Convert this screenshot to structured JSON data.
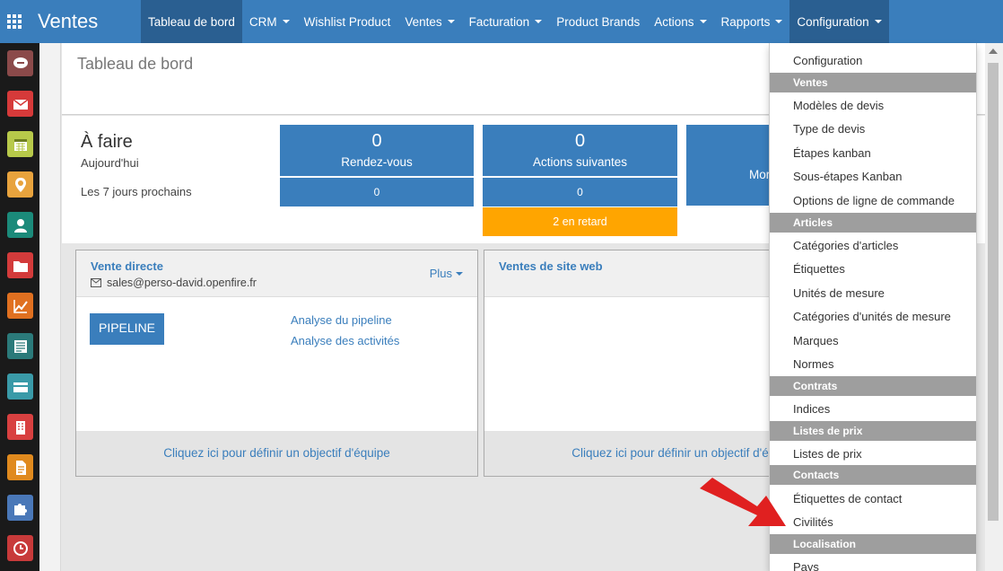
{
  "app": {
    "title": "Ventes"
  },
  "menu": [
    {
      "label": "Tableau de bord",
      "caret": false,
      "active": true
    },
    {
      "label": "CRM",
      "caret": true
    },
    {
      "label": "Wishlist Product",
      "caret": false
    },
    {
      "label": "Ventes",
      "caret": true
    },
    {
      "label": "Facturation",
      "caret": true
    },
    {
      "label": "Product Brands",
      "caret": false
    },
    {
      "label": "Actions",
      "caret": true
    },
    {
      "label": "Rapports",
      "caret": true
    },
    {
      "label": "Configuration",
      "caret": true,
      "active": true
    }
  ],
  "appbar": [
    {
      "name": "discuss-icon",
      "color": "#8b4a4a"
    },
    {
      "name": "mail-icon",
      "color": "#d63a3a"
    },
    {
      "name": "calendar-icon",
      "color": "#b7c94a"
    },
    {
      "name": "location-icon",
      "color": "#e8a33d"
    },
    {
      "name": "contacts-icon",
      "color": "#1b8a7a"
    },
    {
      "name": "documents-icon",
      "color": "#d33b3b"
    },
    {
      "name": "sales-chart-icon",
      "color": "#e07020"
    },
    {
      "name": "accounting-icon",
      "color": "#2b7a7a"
    },
    {
      "name": "payment-icon",
      "color": "#3a9aa8"
    },
    {
      "name": "company-icon",
      "color": "#d84040"
    },
    {
      "name": "notes-icon",
      "color": "#e08a1e"
    },
    {
      "name": "apps-puzzle-icon",
      "color": "#4a78b8"
    },
    {
      "name": "timesheet-icon",
      "color": "#c83a3a"
    }
  ],
  "breadcrumb": "Tableau de bord",
  "todo": {
    "title": "À faire",
    "today_label": "Aujourd'hui",
    "week_label": "Les 7 jours prochains",
    "cards": [
      {
        "count": "0",
        "label": "Rendez-vous",
        "week": "0"
      },
      {
        "count": "0",
        "label": "Actions suivantes",
        "week": "0",
        "late": "2 en retard"
      },
      {
        "count": "",
        "label": "Mor",
        "week": ""
      }
    ]
  },
  "teams": [
    {
      "name": "Vente directe",
      "email": "sales@perso-david.openfire.fr",
      "more": "Plus",
      "pipeline": "PIPELINE",
      "links": [
        "Analyse du pipeline",
        "Analyse des activités"
      ],
      "footer": "Cliquez ici pour définir un objectif d'équipe"
    },
    {
      "name": "Ventes de site web",
      "footer": "Cliquez ici pour définir un objectif d'équipe"
    }
  ],
  "dropdown": {
    "items": [
      {
        "type": "item",
        "label": "Configuration"
      },
      {
        "type": "header",
        "label": "Ventes"
      },
      {
        "type": "item",
        "label": "Modèles de devis"
      },
      {
        "type": "item",
        "label": "Type de devis"
      },
      {
        "type": "item",
        "label": "Étapes kanban"
      },
      {
        "type": "item",
        "label": "Sous-étapes Kanban"
      },
      {
        "type": "item",
        "label": "Options de ligne de commande"
      },
      {
        "type": "header",
        "label": "Articles"
      },
      {
        "type": "item",
        "label": "Catégories d'articles"
      },
      {
        "type": "item",
        "label": "Étiquettes"
      },
      {
        "type": "item",
        "label": "Unités de mesure"
      },
      {
        "type": "item",
        "label": "Catégories d'unités de mesure"
      },
      {
        "type": "item",
        "label": "Marques"
      },
      {
        "type": "item",
        "label": "Normes"
      },
      {
        "type": "header",
        "label": "Contrats"
      },
      {
        "type": "item",
        "label": "Indices"
      },
      {
        "type": "header",
        "label": "Listes de prix"
      },
      {
        "type": "item",
        "label": "Listes de prix"
      },
      {
        "type": "header",
        "label": "Contacts"
      },
      {
        "type": "item",
        "label": "Étiquettes de contact"
      },
      {
        "type": "item",
        "label": "Civilités"
      },
      {
        "type": "header",
        "label": "Localisation"
      },
      {
        "type": "item",
        "label": "Pays"
      }
    ]
  },
  "colors": {
    "primary": "#3a7ebc",
    "late": "#ffa500",
    "arrow": "#e02020"
  }
}
